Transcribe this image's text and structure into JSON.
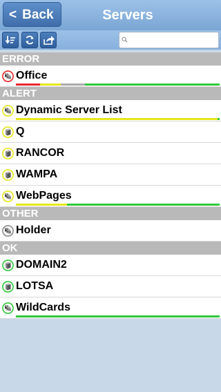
{
  "header": {
    "back_label": "Back",
    "back_chevron": "<",
    "title": "Servers"
  },
  "toolbar": {
    "buttons": [
      "sort-icon",
      "refresh-icon",
      "share-icon"
    ],
    "search_value": "",
    "search_placeholder": ""
  },
  "colors": {
    "error": "#e8262a",
    "alert": "#e6e61a",
    "ok": "#2fc83a",
    "unknown": "#aaaaaa"
  },
  "sections": [
    {
      "title": "ERROR",
      "rows": [
        {
          "name": "Office",
          "status": "error",
          "icon": "server-cluster-icon",
          "bar": [
            {
              "c": "#e8262a",
              "f": 0.12
            },
            {
              "c": "#e6e61a",
              "f": 0.1
            },
            {
              "c": "#aaaaaa",
              "f": 0.12
            },
            {
              "c": "#2fc83a",
              "f": 0.66
            }
          ]
        }
      ]
    },
    {
      "title": "ALERT",
      "rows": [
        {
          "name": "Dynamic Server List",
          "status": "alert",
          "icon": "server-cluster-icon",
          "bar": [
            {
              "c": "#e6e61a",
              "f": 0.99
            },
            {
              "c": "#2fc83a",
              "f": 0.01
            }
          ]
        },
        {
          "name": "Q",
          "status": "alert",
          "icon": "server-icon",
          "bar": []
        },
        {
          "name": "RANCOR",
          "status": "alert",
          "icon": "server-icon",
          "bar": []
        },
        {
          "name": "WAMPA",
          "status": "alert",
          "icon": "server-icon",
          "bar": []
        },
        {
          "name": "WebPages",
          "status": "alert",
          "icon": "server-cluster-icon",
          "bar": [
            {
              "c": "#e6e61a",
              "f": 0.25
            },
            {
              "c": "#2fc83a",
              "f": 0.75
            }
          ]
        }
      ]
    },
    {
      "title": "OTHER",
      "rows": [
        {
          "name": "Holder",
          "status": "other",
          "icon": "server-cluster-icon",
          "bar": []
        }
      ]
    },
    {
      "title": "OK",
      "rows": [
        {
          "name": "DOMAIN2",
          "status": "ok",
          "icon": "server-icon",
          "bar": []
        },
        {
          "name": "LOTSA",
          "status": "ok",
          "icon": "server-icon",
          "bar": []
        },
        {
          "name": "WildCards",
          "status": "ok",
          "icon": "server-cluster-icon",
          "bar": [
            {
              "c": "#2fc83a",
              "f": 1.0
            }
          ]
        }
      ]
    }
  ]
}
